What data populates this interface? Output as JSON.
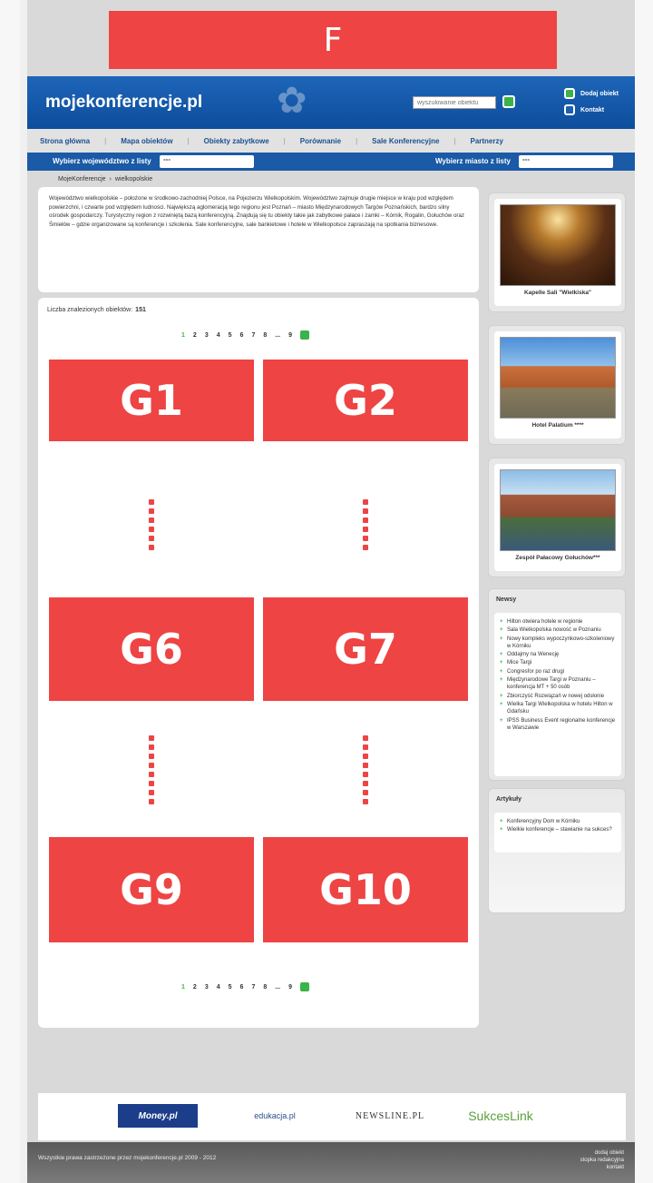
{
  "placeholder_top": "F",
  "header": {
    "logo": "mojekonferencje.pl",
    "search_placeholder": "wyszukiwanie obiektu",
    "links": [
      "Dodaj obiekt",
      "Kontakt"
    ]
  },
  "nav": [
    "Strona główna",
    "Mapa obiektów",
    "Obiekty zabytkowe",
    "Porównanie",
    "Sale Konferencyjne",
    "Partnerzy"
  ],
  "selectbar": {
    "left_label": "Wybierz województwo z listy",
    "left_value": "---",
    "right_label": "Wybierz miasto z listy",
    "right_value": "---"
  },
  "breadcrumb": [
    "MojeKonferencje",
    "wielkopolskie"
  ],
  "intro_text": "Województwo wielkopolskie – położone w środkowo-zachodniej Polsce, na Pojezierzu Wielkopolskim. Województwo zajmuje drugie miejsce w kraju pod względem powierzchni, i czwarte pod względem ludności. Największą aglomeracją tego regionu jest Poznań – miasto Międzynarodowych Targów Poznańskich, bardzo silny ośrodek gospodarczy. Turystyczny region z rozwiniętą bazą konferencyjną. Znajdują się tu obiekty takie jak zabytkowe pałace i zamki – Kórnik, Rogalin, Gołuchów oraz Śmiełów – gdzie organizowane są konferencje i szkolenia. Sale konferencyjne, sale bankietowe i hotele w Wielkopolsce zapraszają na spotkania biznesowe.",
  "main": {
    "count_label": "Liczba znalezionych obiektów:",
    "count_value": "151",
    "pages": [
      "1",
      "2",
      "3",
      "4",
      "5",
      "6",
      "7",
      "8",
      "...",
      "9"
    ],
    "tiles": [
      "G1",
      "G2",
      "G6",
      "G7",
      "G9",
      "G10"
    ]
  },
  "side_cards": [
    {
      "caption": "Kapelle Sali \"Wielkiska\""
    },
    {
      "caption": "Hotel Palatium ****"
    },
    {
      "caption": "Zespół Pałacowy Gołuchów***"
    }
  ],
  "news": {
    "title": "Newsy",
    "items": [
      "Hilton otwiera hotele w regionie",
      "Sala Wielkopolska nowość w Poznaniu",
      "Nowy kompleks wypoczynkowo-szkoleniowy w Kórniku",
      "Oddajmy na Wenecję",
      "Mice Targi",
      "Congresfor po raz drugi",
      "Międzynarodowe Targi w Poznaniu – konferencja MT + 50 osób",
      "Zbiorczyść Rozwiązań w nowej odsłonie",
      "Wielka Targi Wielkopolska w hotelu Hilton w Gdańsku",
      "IPSS Business Event regionalne konferencje w Warszawie"
    ]
  },
  "articles": {
    "title": "Artykuły",
    "items": [
      "Konferencyjny Dom w Kórniku",
      "Wielkie konferencje – stawianie na sukces?"
    ]
  },
  "partners": [
    "Money.pl",
    "edukacja.pl",
    "NEWSLINE.PL",
    "SukcesLink"
  ],
  "footer": {
    "copyright": "Wszystkie prawa zastrzeżone przez mojekonferencje.pl 2009 - 2012",
    "links": [
      "dodaj obiekt",
      "stopka redakcyjna",
      "kontakt"
    ]
  }
}
